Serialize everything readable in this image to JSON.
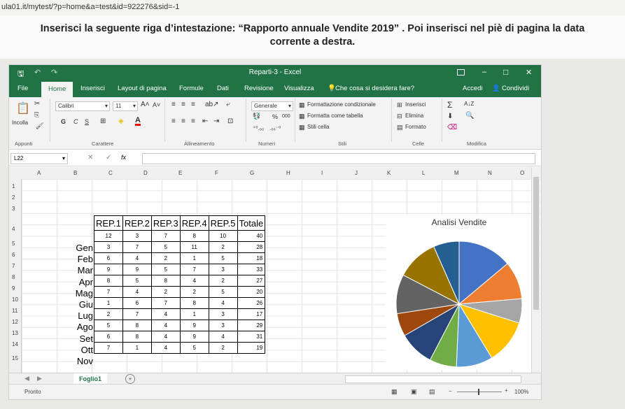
{
  "url": "ula01.it/mytest/?p=home&a=test&id=922276&sid=-1",
  "question": {
    "line1": "Inserisci la seguente riga d’intestazione: “Rapporto annuale Vendite 2019” . Poi inserisci nel piè di pagina la data",
    "line2": "corrente a destra."
  },
  "window": {
    "title": "Reparti-3 - Excel",
    "minimize": "–",
    "maximize": "□",
    "close": "✕",
    "qat_save": "🖫",
    "qat_undo": "↶",
    "qat_redo": "↷"
  },
  "tabs": [
    "File",
    "Home",
    "Inserisci",
    "Layout di pagina",
    "Formule",
    "Dati",
    "Revisione",
    "Visualizza"
  ],
  "tell_me": "Che cosa si desidera fare?",
  "signin": "Accedi",
  "share": "Condividi",
  "ribbon": {
    "paste": "Incolla",
    "font_name": "Calibri",
    "font_size": "11",
    "bold": "G",
    "italic": "C",
    "underline": "S",
    "number_format": "Generale",
    "percent": "%",
    "thousands": "000",
    "cond_format": "Formattazione condizionale",
    "format_table": "Formatta come tabella",
    "cell_styles": "Stili cella",
    "insert": "Inserisci",
    "delete": "Elimina",
    "format": "Formato",
    "groups": [
      "Appunti",
      "Carattere",
      "Allineamento",
      "Numeri",
      "Stili",
      "Celle",
      "Modifica"
    ]
  },
  "namebox": "L22",
  "fx": "fx",
  "columns": [
    "A",
    "B",
    "C",
    "D",
    "E",
    "F",
    "G",
    "H",
    "I",
    "J",
    "K",
    "L",
    "M",
    "N",
    "O"
  ],
  "rows": [
    "1",
    "2",
    "3",
    "4",
    "5",
    "6",
    "7",
    "8",
    "9",
    "10",
    "11",
    "12",
    "13",
    "14",
    "15"
  ],
  "table": {
    "headers": [
      "REP.1",
      "REP.2",
      "REP.3",
      "REP.4",
      "REP.5",
      "Totale"
    ],
    "months": [
      "Gen",
      "Feb",
      "Mar",
      "Apr",
      "Mag",
      "Giu",
      "Lug",
      "Ago",
      "Set",
      "Ott",
      "Nov"
    ],
    "values": [
      [
        "12",
        "3",
        "7",
        "8",
        "10",
        "40"
      ],
      [
        "3",
        "7",
        "5",
        "11",
        "2",
        "28"
      ],
      [
        "6",
        "4",
        "2",
        "1",
        "5",
        "18"
      ],
      [
        "9",
        "9",
        "5",
        "7",
        "3",
        "33"
      ],
      [
        "8",
        "5",
        "8",
        "4",
        "2",
        "27"
      ],
      [
        "7",
        "4",
        "2",
        "2",
        "5",
        "20"
      ],
      [
        "1",
        "6",
        "7",
        "8",
        "4",
        "26"
      ],
      [
        "2",
        "7",
        "4",
        "1",
        "3",
        "17"
      ],
      [
        "5",
        "8",
        "4",
        "9",
        "3",
        "29"
      ],
      [
        "6",
        "8",
        "4",
        "9",
        "4",
        "31"
      ],
      [
        "7",
        "1",
        "4",
        "5",
        "2",
        "19"
      ]
    ]
  },
  "chart": {
    "title": "Analisi Vendite",
    "colors": [
      "#4472c4",
      "#ed7d31",
      "#a5a5a5",
      "#ffc000",
      "#5b9bd5",
      "#70ad47",
      "#264478",
      "#9e480e",
      "#636363",
      "#997300",
      "#255e91",
      "#43682b"
    ]
  },
  "sheet_tab": "Foglio1",
  "add_sheet": "+",
  "status_text": "Pronto",
  "zoom": "100%"
}
